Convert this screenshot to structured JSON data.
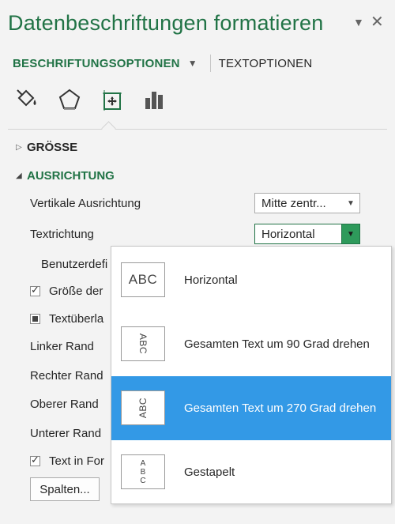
{
  "pane": {
    "title": "Datenbeschriftungen formatieren",
    "menu_glyph": "▼",
    "close_glyph": "✕"
  },
  "tabs": {
    "active_label": "BESCHRIFTUNGSOPTIONEN",
    "other_label": "TEXTOPTIONEN"
  },
  "icons": [
    "fill-line-icon",
    "effects-icon",
    "size-properties-icon",
    "label-options-icon"
  ],
  "sections": {
    "size": "GRÖSSE",
    "alignment": "AUSRICHTUNG"
  },
  "rows": {
    "vertical_alignment": {
      "label": "Vertikale Ausrichtung",
      "value": "Mitte zentr..."
    },
    "text_direction": {
      "label": "Textrichtung",
      "value": "Horizontal"
    },
    "custom_angle": "Benutzerdefi",
    "resize_shape": "Größe der",
    "text_overflow": "Textüberla",
    "left_margin": "Linker Rand",
    "right_margin": "Rechter Rand",
    "top_margin": "Oberer Rand",
    "bottom_margin": "Unterer Rand",
    "wrap_text": "Text in For",
    "columns_button": "Spalten..."
  },
  "popup": {
    "options": [
      {
        "label": "Horizontal",
        "preview": "ABC"
      },
      {
        "label": "Gesamten Text um 90 Grad drehen",
        "preview": "ABC"
      },
      {
        "label": "Gesamten Text um 270 Grad drehen",
        "preview": "ABC"
      },
      {
        "label": "Gestapelt",
        "preview": [
          "A",
          "B",
          "C"
        ]
      }
    ],
    "selected_index": 2
  },
  "colors": {
    "accent_green": "#217346",
    "selection_blue": "#3399e6",
    "pane_bg": "#f3f3f3"
  }
}
